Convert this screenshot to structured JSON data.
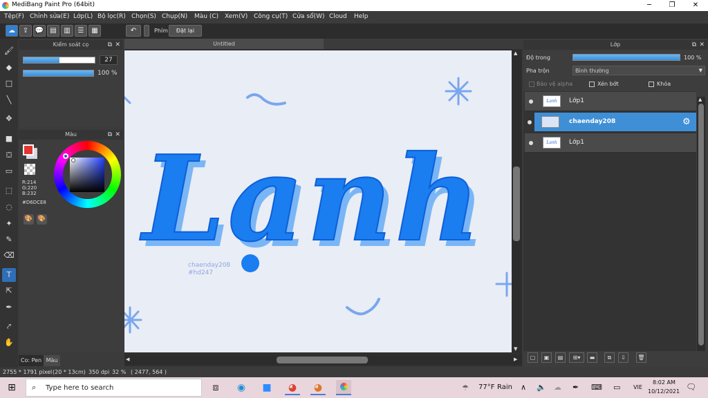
{
  "window": {
    "title": "MediBang Paint Pro (64bit)"
  },
  "menu": [
    "Tệp(F)",
    "Chỉnh sửa(E)",
    "Lớp(L)",
    "Bộ lọc(R)",
    "Chọn(S)",
    "Chụp(N)",
    "Màu (C)",
    "Xem(V)",
    "Công cụ(T)",
    "Cửa sổ(W)",
    "Cloud",
    "Help"
  ],
  "toolbar": {
    "phim_label": "Phím",
    "reset_label": "Đặt lại"
  },
  "brush_panel": {
    "title": "Kiểm soát cọ",
    "size_value": "27",
    "opacity_value": "100 %",
    "size_fraction": 0.5,
    "opacity_fraction": 1.0
  },
  "color_panel": {
    "title": "Màu",
    "r": "R:214",
    "g": "G:220",
    "b": "B:232",
    "hex": "#D6DCE8",
    "fg_color": "#e33333",
    "bg_color": "#D6DCE8"
  },
  "tool_tabs": {
    "pen": "Co: Pen",
    "color": "Màu"
  },
  "canvas": {
    "tab_title": "Untitled",
    "artwork_text": "Lanh",
    "signature_line1": "chaenday208",
    "signature_line2": "#hd247",
    "bg": "#e9edf6",
    "ink": "#1a7df0"
  },
  "layer_panel": {
    "title": "Lớp",
    "opacity_label": "Độ trong",
    "opacity_value": "100 %",
    "opacity_fraction": 1.0,
    "blend_label": "Pha trộn",
    "blend_value": "Bình thường",
    "protect_alpha": "Bảo vệ alpha",
    "clipping": "Xén bớt",
    "lock": "Khóa",
    "layers": [
      {
        "name": "Lớp1",
        "selected": false
      },
      {
        "name": "chaenday208",
        "selected": true
      },
      {
        "name": "Lớp1",
        "selected": false
      }
    ]
  },
  "status": {
    "size": "2755 * 1791 pixel",
    "cm": "(20 * 13cm)",
    "dpi": "350 dpi",
    "zoom": "32 %",
    "coords": "( 2477, 564 )"
  },
  "taskbar": {
    "search_placeholder": "Type here to search",
    "weather_temp": "77°F",
    "weather_text": "Rain",
    "lang": "VIE",
    "time": "8:02 AM",
    "date": "10/12/2021"
  }
}
